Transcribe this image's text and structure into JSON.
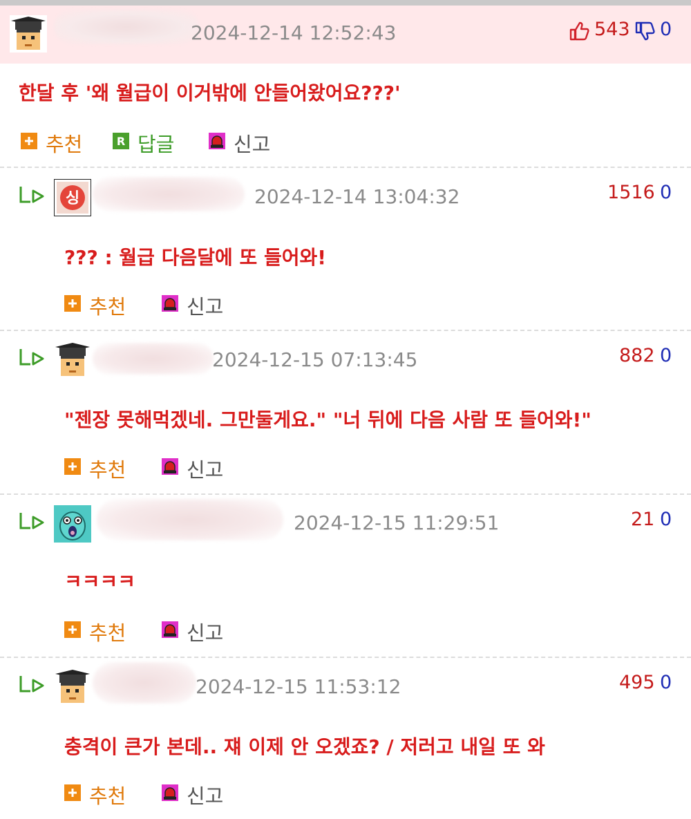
{
  "comments": [
    {
      "date": "2024-12-14 12:52:43",
      "upvotes": "543",
      "downvotes": "0",
      "text": "한달 후 '왜 월급이 이거밖에 안들어왔어요???'",
      "actions": {
        "recommend": "추천",
        "reply": "답글",
        "report": "신고"
      },
      "avatar": "graduate-avatar"
    },
    {
      "date": "2024-12-14 13:04:32",
      "upvotes": "1516",
      "downvotes": "0",
      "text": "??? : 월급 다음달에 또 들어와!",
      "actions": {
        "recommend": "추천",
        "report": "신고"
      },
      "avatar": "red-badge-avatar"
    },
    {
      "date": "2024-12-15 07:13:45",
      "upvotes": "882",
      "downvotes": "0",
      "text": "\"젠장 못해먹겠네. 그만둘게요.\" \"너 뒤에 다음 사람 또 들어와!\"",
      "actions": {
        "recommend": "추천",
        "report": "신고"
      },
      "avatar": "graduate-avatar"
    },
    {
      "date": "2024-12-15 11:29:51",
      "upvotes": "21",
      "downvotes": "0",
      "text": "ㅋㅋㅋㅋ",
      "actions": {
        "recommend": "추천",
        "report": "신고"
      },
      "avatar": "cartoon-face-avatar"
    },
    {
      "date": "2024-12-15 11:53:12",
      "upvotes": "495",
      "downvotes": "0",
      "text": "충격이 큰가 본데.. 쟤 이제 안 오겠죠? / 저러고 내일 또 와",
      "actions": {
        "recommend": "추천",
        "report": "신고"
      },
      "avatar": "graduate-avatar"
    }
  ],
  "colors": {
    "highlight_bg": "#ffe8ea",
    "comment_text": "#d81c1c",
    "upvote": "#c41a1a",
    "downvote": "#1f2db5",
    "date": "#8a8a8a",
    "recommend": "#e07a0c",
    "reply": "#3d9c28"
  },
  "icons": [
    "thumbs-up-icon",
    "thumbs-down-icon",
    "plus-icon",
    "reply-r-icon",
    "siren-icon",
    "reply-arrow-icon"
  ]
}
